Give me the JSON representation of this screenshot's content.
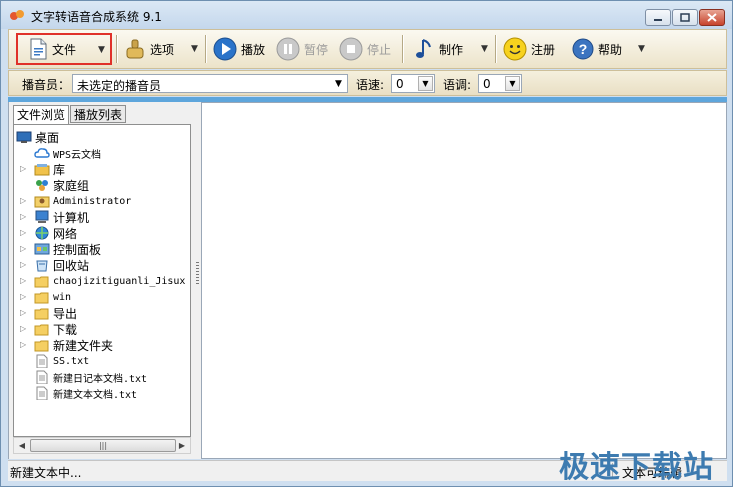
{
  "window": {
    "title": "文字转语音合成系统 9.1"
  },
  "toolbar": {
    "file": "文件",
    "options": "选项",
    "play": "播放",
    "pause": "暂停",
    "stop": "停止",
    "make": "制作",
    "register": "注册",
    "help": "帮助"
  },
  "voicebar": {
    "announcer_label": "播音员：",
    "announcer_value": "未选定的播音员",
    "speed_label": "语速:",
    "speed_value": "0",
    "tone_label": "语调:",
    "tone_value": "0"
  },
  "tabs": {
    "browse": "文件浏览",
    "playlist": "播放列表"
  },
  "tree": [
    {
      "label": "桌面",
      "icon": "desktop-icon"
    },
    {
      "label": "WPS云文档",
      "icon": "cloud-icon"
    },
    {
      "label": "库",
      "icon": "library-icon"
    },
    {
      "label": "家庭组",
      "icon": "homegroup-icon"
    },
    {
      "label": "Administrator",
      "icon": "user-folder-icon"
    },
    {
      "label": "计算机",
      "icon": "computer-icon"
    },
    {
      "label": "网络",
      "icon": "network-icon"
    },
    {
      "label": "控制面板",
      "icon": "control-panel-icon"
    },
    {
      "label": "回收站",
      "icon": "recycle-bin-icon"
    },
    {
      "label": "chaojizitiguanli_Jisux",
      "icon": "folder-icon"
    },
    {
      "label": "win",
      "icon": "folder-icon"
    },
    {
      "label": "导出",
      "icon": "folder-icon"
    },
    {
      "label": "下载",
      "icon": "folder-icon"
    },
    {
      "label": "新建文件夹",
      "icon": "folder-icon"
    },
    {
      "label": "SS.txt",
      "icon": "text-file-icon"
    },
    {
      "label": "新建日记本文档.txt",
      "icon": "text-file-icon"
    },
    {
      "label": "新建文本文档.txt",
      "icon": "text-file-icon"
    }
  ],
  "status": {
    "left": "新建文本中...",
    "right": "文本可编辑"
  },
  "watermark": {
    "text": "极速下载站"
  },
  "colors": {
    "accent_strip": "#5ea6dc",
    "highlight_border": "#e0312a",
    "toolbar_bg": "#ece3c9"
  }
}
